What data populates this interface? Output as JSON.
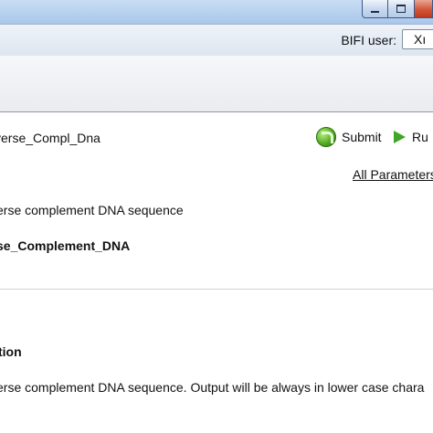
{
  "window": {
    "buttons": {
      "minimize": "minimize-icon",
      "maximize": "maximize-icon",
      "close": "close-icon"
    }
  },
  "header": {
    "user_label": "BIFI user:",
    "user_value": "Xı"
  },
  "tool": {
    "title": "verse_Compl_Dna",
    "submit_label": "Submit",
    "submit_icon": "submit-globe-icon",
    "run_label": "Ru",
    "run_icon": "play-icon",
    "all_parameters_label": "All Parameters",
    "short_description": "erse complement DNA sequence",
    "name": "se_Complement_DNA"
  },
  "section": {
    "heading": "tion",
    "text": "erse complement DNA sequence. Output will be always in lower case chara"
  },
  "colors": {
    "titlebar": "#b7d0ee",
    "accent_green": "#3fa628",
    "close_red": "#d2563a"
  }
}
